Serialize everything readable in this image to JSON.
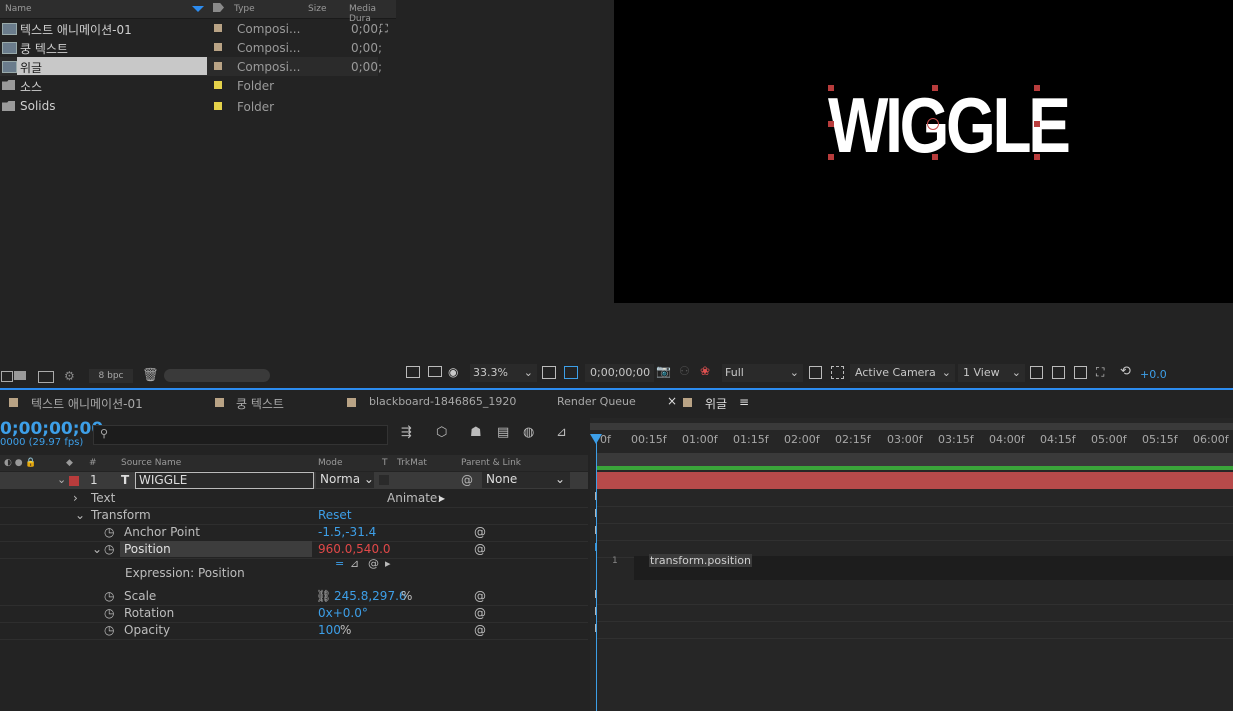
{
  "project": {
    "headers": {
      "name": "Name",
      "type": "Type",
      "size": "Size",
      "duration": "Media Dura"
    },
    "items": [
      {
        "name": "텍스트 애니메이션-01",
        "type": "Composi...",
        "duration": "0;00;",
        "label_color": "#b9a385"
      },
      {
        "name": "쿵 텍스트",
        "type": "Composi...",
        "duration": "0;00;",
        "label_color": "#b9a385"
      },
      {
        "name": "위글",
        "type": "Composi...",
        "duration": "0;00;",
        "label_color": "#b9a385",
        "selected": true
      },
      {
        "name": "소스",
        "type": "Folder",
        "duration": "",
        "label_color": "#e4d24a"
      },
      {
        "name": "Solids",
        "type": "Folder",
        "duration": "",
        "label_color": "#e4d24a"
      }
    ],
    "bpc": "8 bpc"
  },
  "viewer": {
    "canvas_text": "WIGGLE",
    "zoom": "33.3%",
    "timecode": "0;00;00;00",
    "resolution": "Full",
    "camera": "Active Camera",
    "views": "1 View",
    "exposure": "+0.0"
  },
  "tabs": [
    {
      "label": "텍스트 애니메이션-01"
    },
    {
      "label": "쿵 텍스트"
    },
    {
      "label": "blackboard-1846865_1920"
    },
    {
      "label": "Render Queue"
    },
    {
      "label": "위글",
      "active": true
    }
  ],
  "timeline": {
    "timecode": "0;00;00;00",
    "fps": "0000 (29.97 fps)",
    "search_placeholder": "",
    "columns": {
      "num": "#",
      "source": "Source Name",
      "mode": "Mode",
      "t": "T",
      "trkmat": "TrkMat",
      "parent": "Parent & Link"
    },
    "layer": {
      "num": "1",
      "name": "WIGGLE",
      "mode": "Norma",
      "parent": "None",
      "label_color": "#b83c3c"
    },
    "props": {
      "text": "Text",
      "animate": "Animate:",
      "transform": "Transform",
      "reset": "Reset",
      "anchor_label": "Anchor Point",
      "anchor_value": "-1.5,-31.4",
      "position_label": "Position",
      "position_value": "960.0,540.0",
      "expression_label": "Expression: Position",
      "scale_label": "Scale",
      "scale_value": "245.8,297.6",
      "scale_unit": "%",
      "rotation_label": "Rotation",
      "rotation_value": "0x+0.0°",
      "opacity_label": "Opacity",
      "opacity_value": "100",
      "opacity_unit": "%"
    },
    "ruler": [
      "0f",
      "00:15f",
      "01:00f",
      "01:15f",
      "02:00f",
      "02:15f",
      "03:00f",
      "03:15f",
      "04:00f",
      "04:15f",
      "05:00f",
      "05:15f",
      "06:00f"
    ],
    "expression_text": "transform.position"
  }
}
